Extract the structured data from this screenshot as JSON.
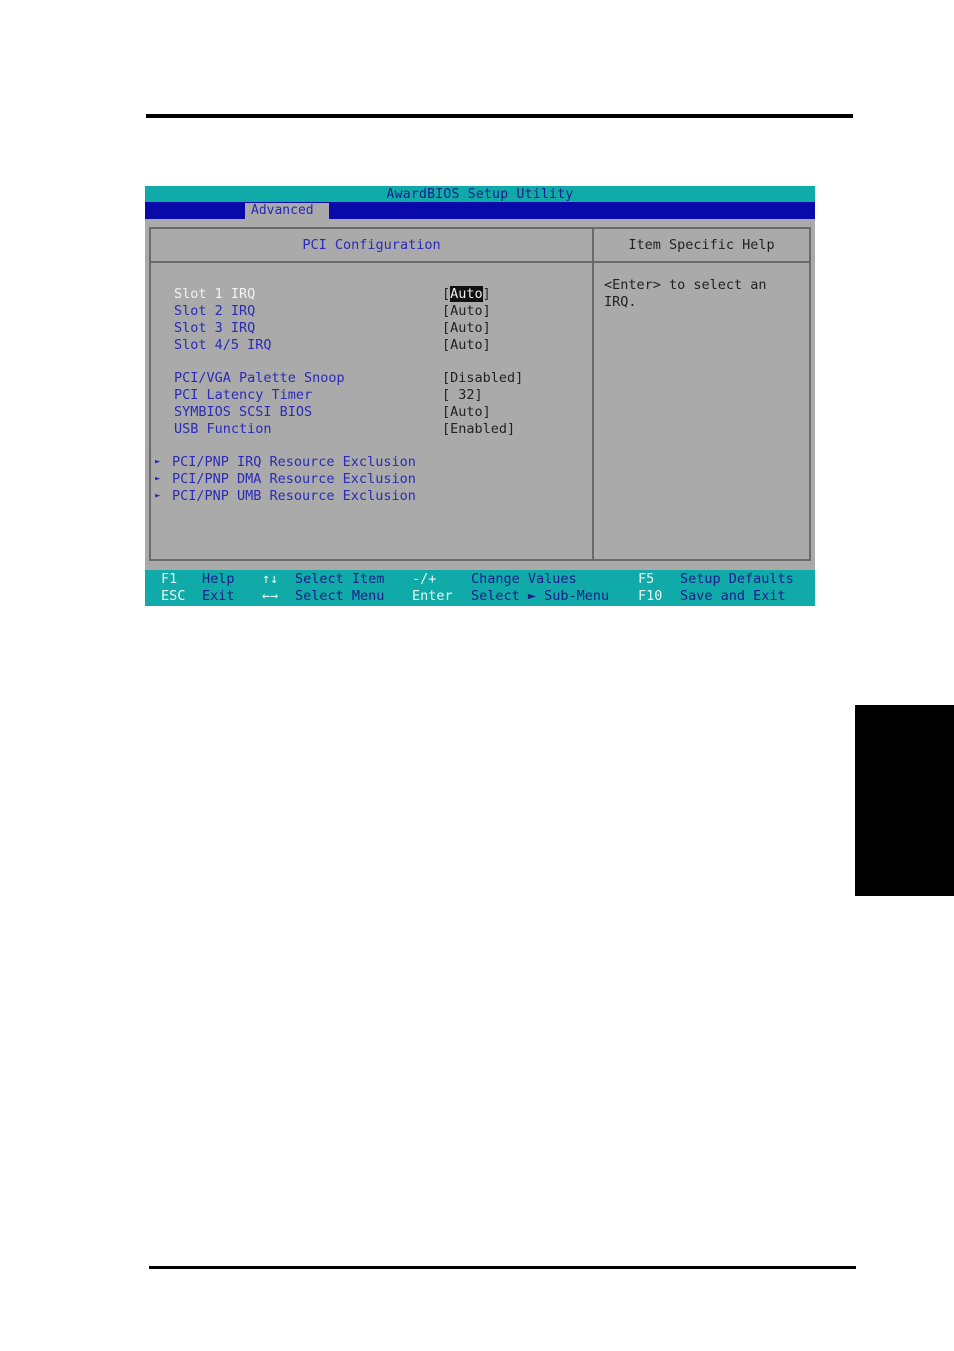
{
  "bios": {
    "title": "AwardBIOS Setup Utility",
    "menu_tabs": [
      {
        "label": "Advanced",
        "active": true
      }
    ],
    "main_panel": {
      "header": "PCI Configuration",
      "items": [
        {
          "label": "Slot 1 IRQ",
          "value_prefix": "[",
          "value": "Auto",
          "value_suffix": "]",
          "selected": true
        },
        {
          "label": "Slot 2 IRQ",
          "value": "[Auto]"
        },
        {
          "label": "Slot 3 IRQ",
          "value": "[Auto]"
        },
        {
          "label": "Slot 4/5 IRQ",
          "value": "[Auto]"
        },
        {
          "label": "PCI/VGA Palette Snoop",
          "value": "[Disabled]"
        },
        {
          "label": "PCI Latency Timer",
          "value": "[ 32]"
        },
        {
          "label": "SYMBIOS SCSI BIOS",
          "value": "[Auto]"
        },
        {
          "label": "USB Function",
          "value": "[Enabled]"
        }
      ],
      "submenus": [
        {
          "label": "PCI/PNP IRQ Resource Exclusion",
          "icon": "triangle-right-icon"
        },
        {
          "label": "PCI/PNP DMA Resource Exclusion",
          "icon": "triangle-right-icon"
        },
        {
          "label": "PCI/PNP UMB Resource Exclusion",
          "icon": "triangle-right-icon"
        }
      ]
    },
    "help_panel": {
      "header": "Item Specific Help",
      "text": "<Enter> to select an\nIRQ."
    },
    "footer": {
      "row1": [
        {
          "key": "F1",
          "desc": "Help"
        },
        {
          "key": "↑↓",
          "desc": "Select Item"
        },
        {
          "key": "-/+",
          "desc": "Change Values"
        },
        {
          "key": "F5",
          "desc": "Setup Defaults"
        }
      ],
      "row2": [
        {
          "key": "ESC",
          "desc": "Exit"
        },
        {
          "key": "←→",
          "desc": "Select Menu"
        },
        {
          "key": "Enter",
          "desc": "Select ► Sub-Menu"
        },
        {
          "key": "F10",
          "desc": "Save and Exit"
        }
      ]
    },
    "colors": {
      "teal_bar": "#10aaa8",
      "menu_bar": "#0a0aa8",
      "panel_bg": "#aaaaaa",
      "item_text": "#2b2bb8",
      "selected_text": "#f2f2f2"
    }
  },
  "page": {
    "side_tab_text": ""
  }
}
